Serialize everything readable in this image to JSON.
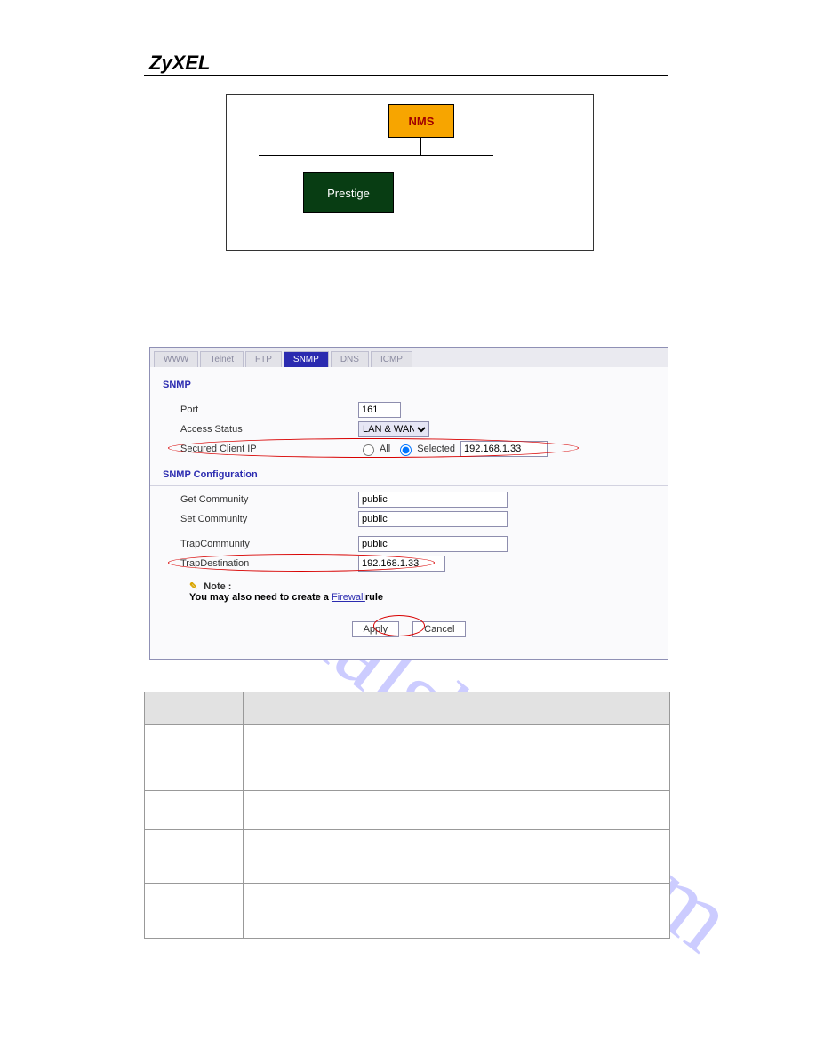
{
  "brand": "ZyXEL",
  "diagram": {
    "nms": "NMS",
    "prestige": "Prestige"
  },
  "ui": {
    "tabs": [
      "WWW",
      "Telnet",
      "FTP",
      "SNMP",
      "DNS",
      "ICMP"
    ],
    "active_tab_index": 3,
    "section1_title": "SNMP",
    "port_label": "Port",
    "port_value": "161",
    "access_status_label": "Access Status",
    "access_status_value": "LAN & WAN",
    "secured_label": "Secured Client IP",
    "radio_all": "All",
    "radio_selected": "Selected",
    "secured_ip": "192.168.1.33",
    "section2_title": "SNMP Configuration",
    "get_comm_label": "Get Community",
    "get_comm_value": "public",
    "set_comm_label": "Set Community",
    "set_comm_value": "public",
    "trap_comm_label": "TrapCommunity",
    "trap_comm_value": "public",
    "trap_dest_label": "TrapDestination",
    "trap_dest_value": "192.168.1.33",
    "note_title": "Note :",
    "note_pre": "You may also need to create a ",
    "note_link": "Firewall",
    "note_post": "rule",
    "apply": "Apply",
    "cancel": "Cancel"
  },
  "watermark": "manualshive.com"
}
